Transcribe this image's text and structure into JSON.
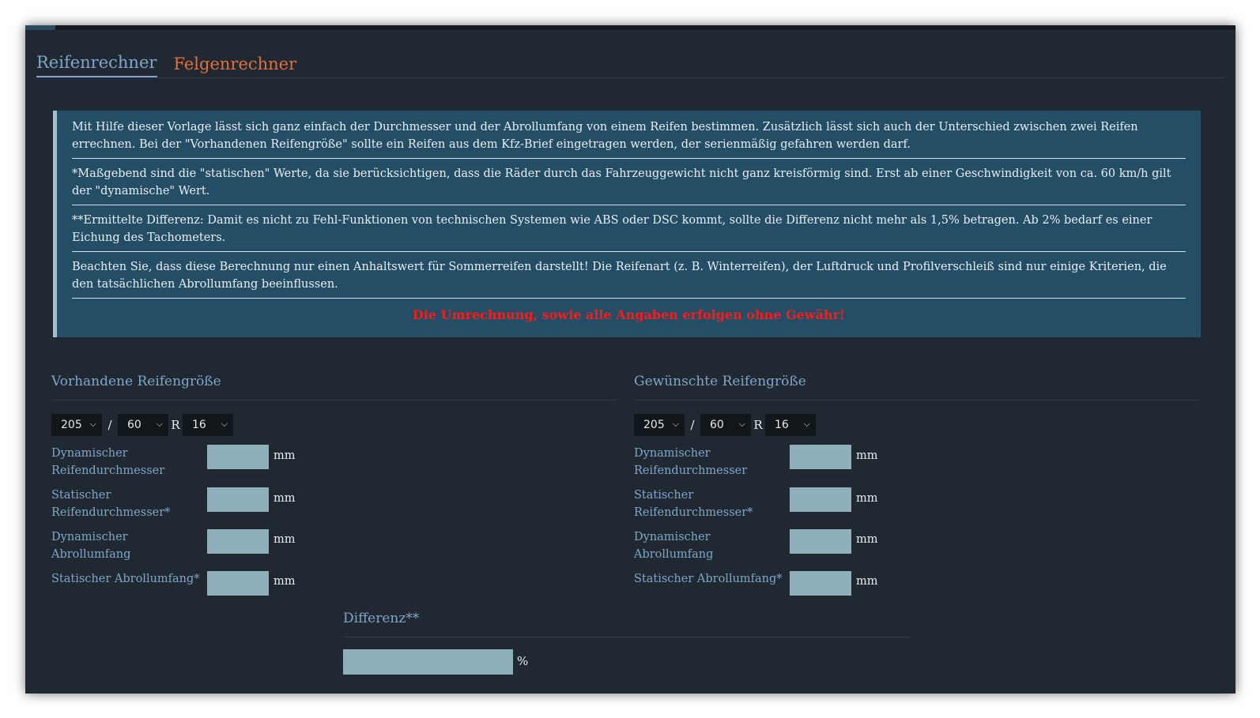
{
  "tabs": [
    {
      "label": "Reifenrechner"
    },
    {
      "label": "Felgenrechner"
    }
  ],
  "info": {
    "paragraph1": "Mit Hilfe dieser Vorlage lässt sich ganz einfach der Durchmesser und der Abrollumfang von einem Reifen bestimmen. Zusätzlich lässt sich auch der Unterschied zwischen zwei Reifen errechnen. Bei der \"Vorhandenen Reifengröße\" sollte ein Reifen aus dem Kfz-Brief eingetragen werden, der serienmäßig gefahren werden darf.",
    "paragraph2": "*Maßgebend sind die \"statischen\" Werte, da sie berücksichtigen, dass die Räder durch das Fahrzeuggewicht nicht ganz kreisförmig sind. Erst ab einer Geschwindigkeit von ca. 60 km/h gilt der \"dynamische\" Wert.",
    "paragraph3": "**Ermittelte Differenz: Damit es nicht zu Fehl-Funktionen von technischen Systemen wie ABS oder DSC kommt, sollte die Differenz nicht mehr als 1,5% betragen. Ab 2% bedarf es einer Eichung des Tachometers.",
    "paragraph4": "Beachten Sie, dass diese Berechnung nur einen Anhaltswert für Sommerreifen darstellt! Die Reifenart (z. B. Winterreifen), der Luftdruck und Profilverschleiß sind nur einige Kriterien, die den tatsächlichen Abrollumfang beeinflussen.",
    "disclaimer": "Die Umrechnung, sowie alle Angaben erfolgen ohne Gewähr!"
  },
  "left": {
    "title": "Vorhandene Reifengröße",
    "width": "205",
    "ratio": "60",
    "rim": "16",
    "slash": "/",
    "r": "R",
    "rows": [
      {
        "label": "Dynamischer Reifendurchmesser",
        "unit": "mm"
      },
      {
        "label": "Statischer Reifendurchmesser*",
        "unit": "mm"
      },
      {
        "label": "Dynamischer Abrollumfang",
        "unit": "mm"
      },
      {
        "label": "Statischer Abrollumfang*",
        "unit": "mm"
      }
    ]
  },
  "right": {
    "title": "Gewünschte Reifengröße",
    "width": "205",
    "ratio": "60",
    "rim": "16",
    "slash": "/",
    "r": "R",
    "rows": [
      {
        "label": "Dynamischer Reifendurchmesser",
        "unit": "mm"
      },
      {
        "label": "Statischer Reifendurchmesser*",
        "unit": "mm"
      },
      {
        "label": "Dynamischer Abrollumfang",
        "unit": "mm"
      },
      {
        "label": "Statischer Abrollumfang*",
        "unit": "mm"
      }
    ]
  },
  "difference": {
    "title": "Differenz**",
    "unit": "%"
  },
  "colors": {
    "background": "#202932",
    "accent_blue": "#7fa6c9",
    "tab_orange": "#e0703c",
    "info_bg": "#234e66",
    "disclaimer_red": "#ff1a1a",
    "input_fill": "#8fb0ba"
  },
  "icons": {
    "select_arrow": "chevron-down-icon"
  }
}
